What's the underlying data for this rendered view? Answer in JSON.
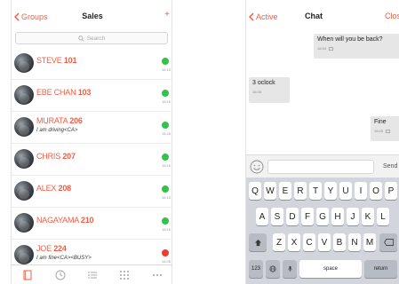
{
  "left": {
    "back_label": "Groups",
    "title": "Sales",
    "add_label": "+",
    "search_placeholder": "Search",
    "contacts": [
      {
        "name": "STEVE",
        "id": "101",
        "status": "",
        "presence": "green",
        "time": "16:15"
      },
      {
        "name": "EBE CHAN",
        "id": "103",
        "status": "",
        "presence": "green",
        "time": "16:15"
      },
      {
        "name": "MURATA",
        "id": "206",
        "status": "I am driving<CA>",
        "presence": "green",
        "time": "16:28"
      },
      {
        "name": "CHRIS",
        "id": "207",
        "status": "",
        "presence": "green",
        "time": "16:15"
      },
      {
        "name": "ALEX",
        "id": "208",
        "status": "",
        "presence": "green",
        "time": "16:15"
      },
      {
        "name": "NAGAYAMA",
        "id": "210",
        "status": "",
        "presence": "green",
        "time": "16:15"
      },
      {
        "name": "JOE",
        "id": "224",
        "status": "I am fine<CA><BUSY>",
        "presence": "red",
        "time": "16:28"
      }
    ],
    "tabs": [
      "contacts",
      "history",
      "list",
      "more"
    ]
  },
  "right": {
    "back_label": "Active",
    "title": "Chat",
    "close_label": "Close",
    "messages": [
      {
        "text": "When will you be back?",
        "time": "16:34"
      },
      {
        "text": "3 oclock",
        "time": "16:35"
      },
      {
        "text": "Fine",
        "time": "16:00"
      }
    ],
    "input_value": "",
    "send_label": "Send",
    "keyboard": {
      "row1": [
        "Q",
        "W",
        "E",
        "R",
        "T",
        "Y",
        "U",
        "I",
        "O",
        "P"
      ],
      "row2": [
        "A",
        "S",
        "D",
        "F",
        "G",
        "H",
        "J",
        "K",
        "L"
      ],
      "row3": [
        "Z",
        "X",
        "C",
        "V",
        "B",
        "N",
        "M"
      ],
      "num_label": "123",
      "space_label": "space",
      "return_label": "return"
    }
  },
  "colors": {
    "accent": "#f25c45",
    "online": "#33c24d",
    "busy": "#f23a2f"
  }
}
